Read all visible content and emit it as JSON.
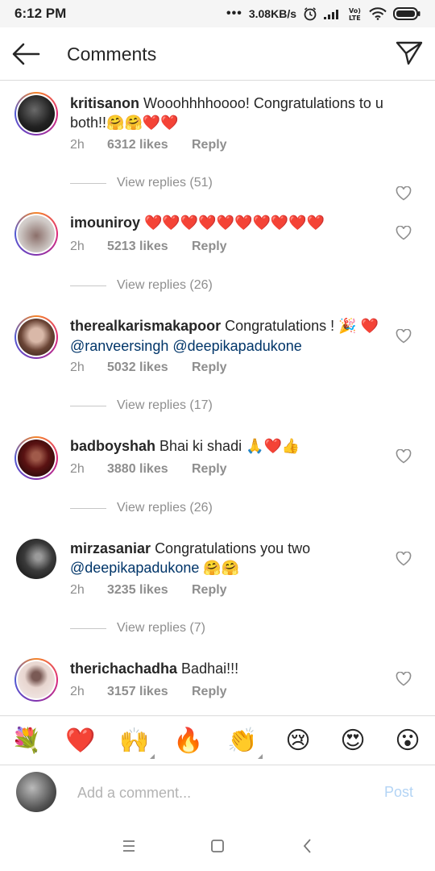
{
  "status_bar": {
    "time": "6:12 PM",
    "dots": "•••",
    "speed": "3.08KB/s",
    "lte_label": "Vo) LTE",
    "icons": [
      "alarm-icon",
      "signal-icon",
      "volte-icon",
      "wifi-icon",
      "battery-icon"
    ]
  },
  "header": {
    "title": "Comments",
    "back_icon": "arrow-left-icon",
    "share_icon": "paper-plane-icon"
  },
  "comments": [
    {
      "username": "kritisanon",
      "text": "Wooohhhhoooo! Congratulations to u both!!",
      "emojis": "🤗🤗❤️❤️",
      "time": "2h",
      "likes": "6312 likes",
      "reply": "Reply",
      "view_replies": "View replies (51)",
      "avatar_colors": [
        "#3a3a3a",
        "#111111"
      ]
    },
    {
      "username": "imouniroy",
      "text": "",
      "emojis": "❤️❤️❤️❤️❤️❤️❤️❤️❤️❤️",
      "time": "2h",
      "likes": "5213 likes",
      "reply": "Reply",
      "view_replies": "View replies (26)",
      "avatar_colors": [
        "#cfc9c6",
        "#5d4a48"
      ]
    },
    {
      "username": "therealkarismakapoor",
      "text": "Congratulations !",
      "emojis": "🎉",
      "text2_emoji": "❤️",
      "mentions": [
        "@ranveersingh",
        "@deepikapadukone"
      ],
      "time": "2h",
      "likes": "5032 likes",
      "reply": "Reply",
      "view_replies": "View replies (17)",
      "avatar_colors": [
        "#d9b8a8",
        "#4a3026"
      ]
    },
    {
      "username": "badboyshah",
      "text": "Bhai ki shadi",
      "emojis": "🙏❤️👍",
      "time": "2h",
      "likes": "3880 likes",
      "reply": "Reply",
      "view_replies": "View replies (26)",
      "avatar_colors": [
        "#7a1a1a",
        "#1a0a0a"
      ]
    },
    {
      "username": "mirzasaniar",
      "text": "Congratulations you two",
      "mention": "@deepikapadukone",
      "emojis": "🤗🤗",
      "time": "2h",
      "likes": "3235 likes",
      "reply": "Reply",
      "view_replies": "View replies (7)",
      "avatar_colors": [
        "#555555",
        "#101010"
      ]
    },
    {
      "username": "therichachadha",
      "text": "Badhai!!!",
      "emojis": "",
      "time": "2h",
      "likes": "3157 likes",
      "reply": "Reply",
      "avatar_colors": [
        "#e8d6d0",
        "#7a5a55"
      ]
    }
  ],
  "emoji_bar": [
    {
      "char": "💐",
      "name": "bouquet-emoji-button"
    },
    {
      "char": "❤️",
      "name": "heart-emoji-button"
    },
    {
      "char": "🙌",
      "name": "raised-hands-emoji-button",
      "has_variants": true
    },
    {
      "char": "🔥",
      "name": "fire-emoji-button"
    },
    {
      "char": "👏",
      "name": "clapping-emoji-button",
      "has_variants": true
    },
    {
      "char": "😢",
      "name": "crying-emoji-button"
    },
    {
      "char": "😍",
      "name": "heart-eyes-emoji-button"
    },
    {
      "char": "😮",
      "name": "surprised-emoji-button"
    }
  ],
  "input": {
    "placeholder": "Add a comment...",
    "value": "",
    "post_label": "Post",
    "post_color": "#b3d4f5"
  },
  "nav": {
    "icons": [
      "menu-icon",
      "home-square-icon",
      "back-chevron-icon"
    ]
  },
  "colors": {
    "primary_text": "#262626",
    "secondary_text": "#8e8e8e",
    "mention": "#003569",
    "heart_red": "#ed4956"
  }
}
